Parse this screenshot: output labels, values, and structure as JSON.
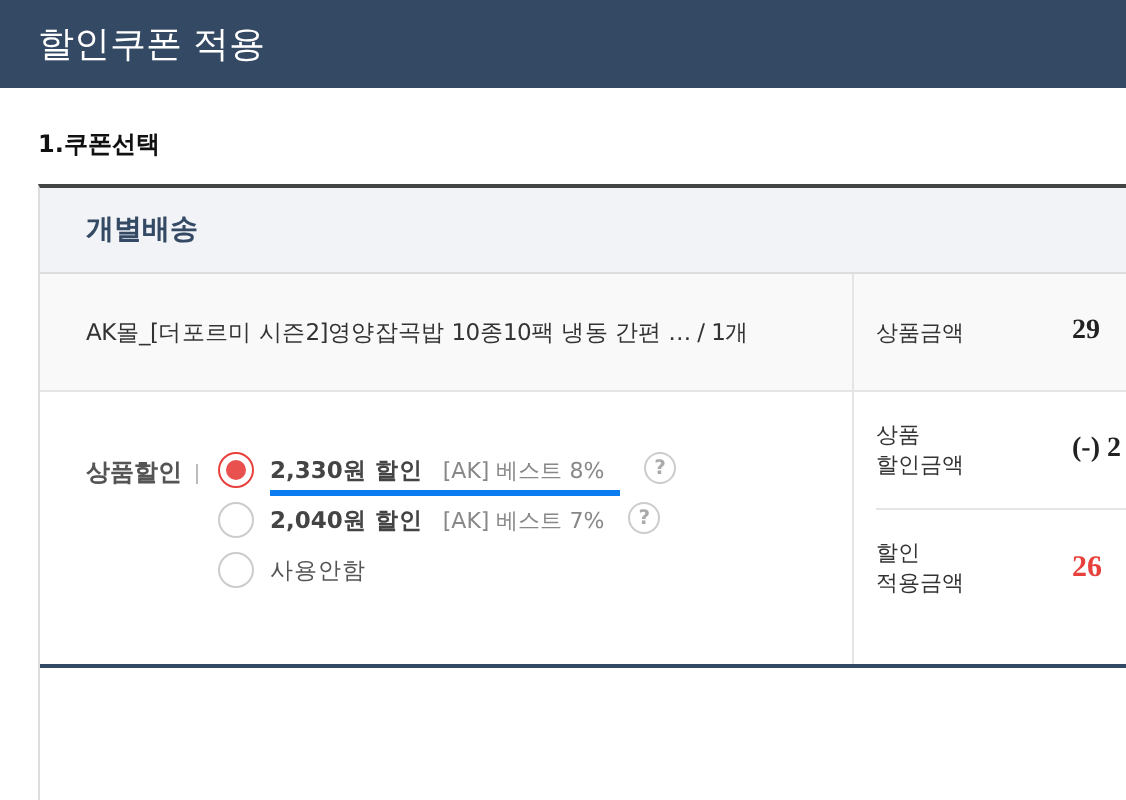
{
  "window": {
    "title": "할인쿠폰 적용"
  },
  "section": {
    "title": "1.쿠폰선택"
  },
  "group": {
    "title": "개별배송"
  },
  "product": {
    "name": "AK몰_[더포르미 시즌2]영양잡곡밥 10종10팩 냉동 간편 … / 1개",
    "price_label": "상품금액",
    "price": "29"
  },
  "discount": {
    "label": "상품할인",
    "options": [
      {
        "amount": "2,330원 할인",
        "coupon": "[AK] 베스트 8%",
        "help": "?",
        "selected": true
      },
      {
        "amount": "2,040원 할인",
        "coupon": "[AK] 베스트 7%",
        "help": "?",
        "selected": false
      },
      {
        "amount": "사용안함",
        "selected": false
      }
    ],
    "summary": [
      {
        "label": "상품\n할인금액",
        "value": "(-) 2",
        "kind": "minus"
      },
      {
        "label": "할인\n적용금액",
        "value": "26",
        "kind": "total"
      }
    ]
  }
}
